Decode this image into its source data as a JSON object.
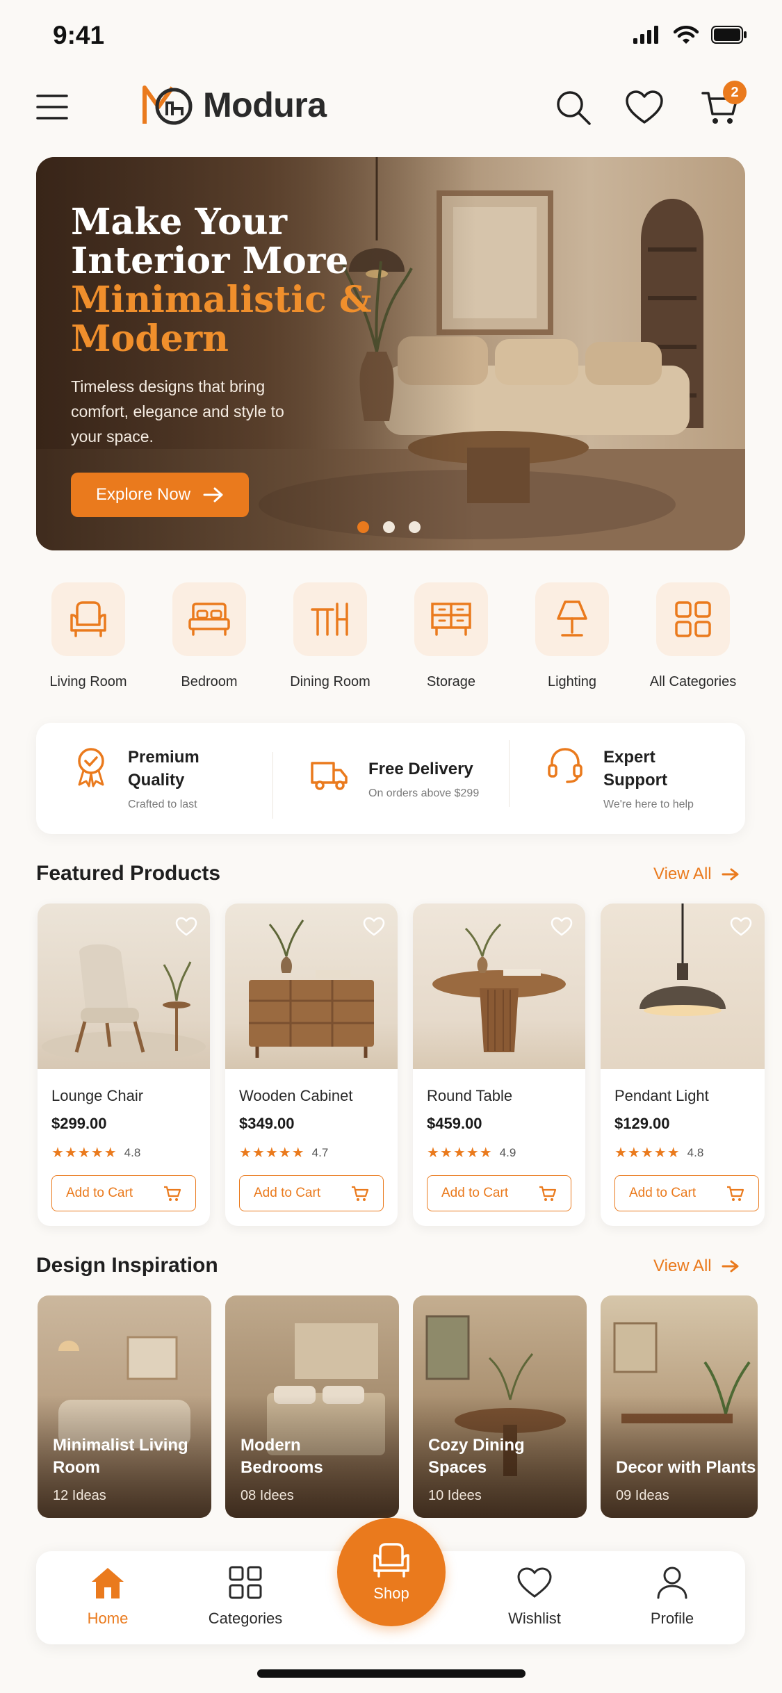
{
  "status_bar": {
    "time": "9:41"
  },
  "header": {
    "brand": "Modura",
    "cart_count": "2"
  },
  "hero": {
    "title_line1": "Make Your",
    "title_line2": "Interior More",
    "title_line3": "Minimalistic &",
    "title_line4": "Modern",
    "subtitle": "Timeless designs that bring comfort, elegance and style to your space.",
    "button_label": "Explore Now",
    "slide_count": 3,
    "active_slide": 1
  },
  "categories": [
    {
      "label": "Living Room",
      "icon": "armchair-icon"
    },
    {
      "label": "Bedroom",
      "icon": "bed-icon"
    },
    {
      "label": "Dining Room",
      "icon": "dining-icon"
    },
    {
      "label": "Storage",
      "icon": "storage-icon"
    },
    {
      "label": "Lighting",
      "icon": "lamp-icon"
    },
    {
      "label": "All Categories",
      "icon": "grid-icon"
    }
  ],
  "features": [
    {
      "title": "Premium Quality",
      "subtitle": "Crafted to last",
      "icon": "award-icon"
    },
    {
      "title": "Free Delivery",
      "subtitle": "On orders above $299",
      "icon": "truck-icon"
    },
    {
      "title": "Expert Support",
      "subtitle": "We're here to help",
      "icon": "headset-icon"
    }
  ],
  "featured": {
    "title": "Featured Products",
    "view_all": "View All",
    "add_to_cart": "Add to Cart",
    "products": [
      {
        "name": "Lounge Chair",
        "price": "$299.00",
        "rating": "4.8"
      },
      {
        "name": "Wooden Cabinet",
        "price": "$349.00",
        "rating": "4.7"
      },
      {
        "name": "Round Table",
        "price": "$459.00",
        "rating": "4.9"
      },
      {
        "name": "Pendant Light",
        "price": "$129.00",
        "rating": "4.8"
      }
    ]
  },
  "inspiration": {
    "title": "Design Inspiration",
    "view_all": "View All",
    "items": [
      {
        "title": "Minimalist Living Room",
        "count": "12 Ideas"
      },
      {
        "title": "Modern Bedrooms",
        "count": "08 Idees"
      },
      {
        "title": "Cozy Dining Spaces",
        "count": "10 Idees"
      },
      {
        "title": "Decor with Plants",
        "count": "09 Ideas"
      }
    ]
  },
  "nav": {
    "home": "Home",
    "categories": "Categories",
    "shop": "Shop",
    "wishlist": "Wishlist",
    "profile": "Profile"
  },
  "colors": {
    "accent": "#ea7a1d",
    "background": "#fbf9f6"
  }
}
